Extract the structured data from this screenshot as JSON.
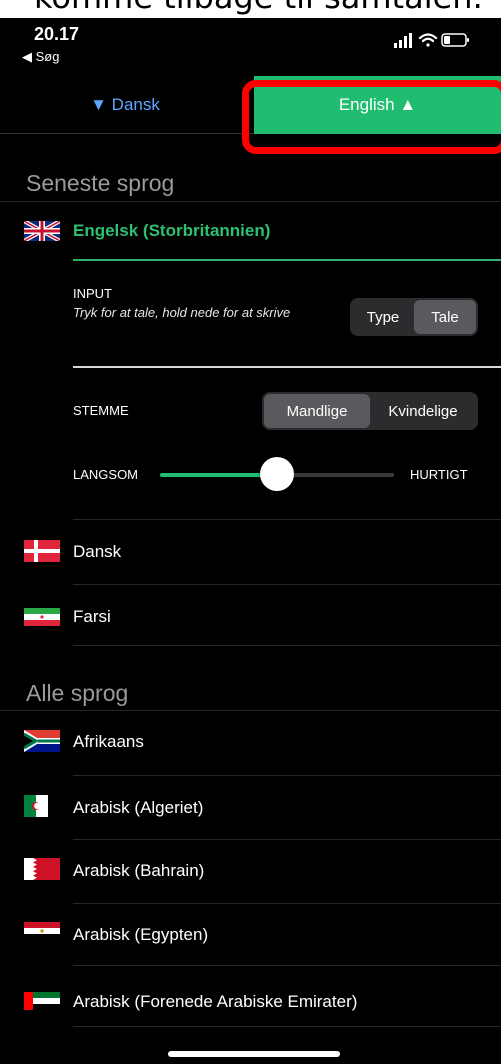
{
  "caption": "komme tilbage til samtalen.",
  "status": {
    "time": "20.17",
    "back": "◀ Søg"
  },
  "langbar": {
    "source": "▼ Dansk",
    "target": "English ▲"
  },
  "recent": {
    "title": "Seneste sprog",
    "selected": "Engelsk (Storbritannien)",
    "input": {
      "title": "INPUT",
      "hint": "Tryk for at tale, hold nede for at skrive",
      "options": [
        "Type",
        "Tale"
      ],
      "selected": "Tale"
    },
    "voice": {
      "title": "STEMME",
      "options": [
        "Mandlige",
        "Kvindelige"
      ],
      "selected": "Mandlige"
    },
    "speed": {
      "slow": "LANGSOM",
      "fast": "HURTIGT",
      "value": 0.5
    },
    "others": [
      {
        "label": "Dansk",
        "flag": "denmark-flag"
      },
      {
        "label": "Farsi",
        "flag": "iran-flag"
      }
    ]
  },
  "all": {
    "title": "Alle sprog",
    "items": [
      {
        "label": "Afrikaans",
        "flag": "south-africa-flag"
      },
      {
        "label": "Arabisk (Algeriet)",
        "flag": "algeria-flag"
      },
      {
        "label": "Arabisk (Bahrain)",
        "flag": "bahrain-flag"
      },
      {
        "label": "Arabisk (Egypten)",
        "flag": "egypt-flag"
      },
      {
        "label": "Arabisk (Forenede Arabiske Emirater)",
        "flag": "uae-flag"
      }
    ]
  },
  "colors": {
    "accent": "#20bd71",
    "highlight": "#ff0000",
    "link": "#5ea6ff"
  }
}
